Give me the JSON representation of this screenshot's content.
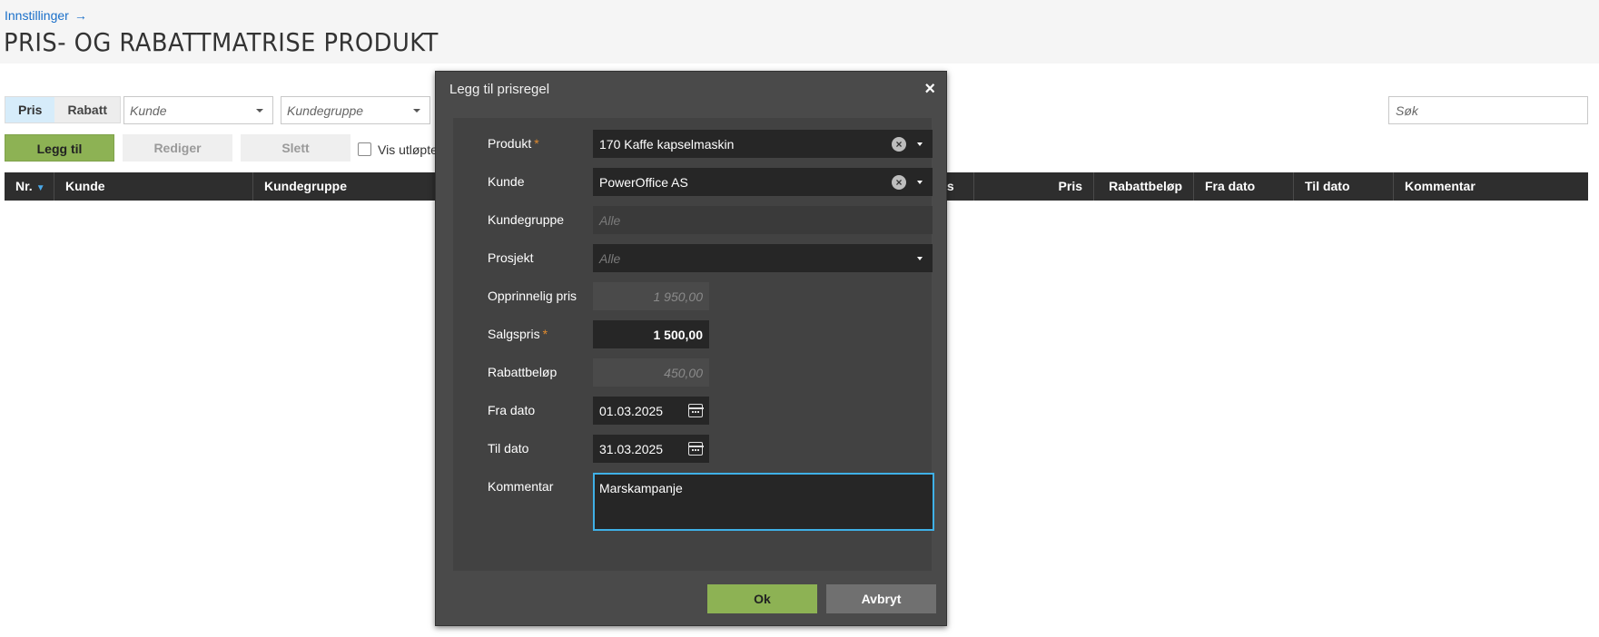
{
  "header": {
    "breadcrumb": "Innstillinger",
    "breadcrumb_arrow": "→",
    "title": "PRIS- OG RABATTMATRISE PRODUKT"
  },
  "toolbar": {
    "segments": [
      "Pris",
      "Rabatt"
    ],
    "active_segment": "Pris",
    "customer_placeholder": "Kunde",
    "customer_group_placeholder": "Kundegruppe",
    "search_placeholder": "Søk",
    "add_label": "Legg til",
    "edit_label": "Rediger",
    "delete_label": "Slett",
    "show_expired_label": "Vis utløpte"
  },
  "grid": {
    "columns": [
      "Nr.",
      "Kunde",
      "Kundegruppe",
      "is",
      "Pris",
      "Rabattbeløp",
      "Fra dato",
      "Til dato",
      "Kommentar"
    ]
  },
  "modal": {
    "title": "Legg til prisregel",
    "close": "×",
    "fields": {
      "product_label": "Produkt",
      "product_value": "170 Kaffe kapselmaskin",
      "customer_label": "Kunde",
      "customer_value": "PowerOffice AS",
      "customer_group_label": "Kundegruppe",
      "customer_group_placeholder": "Alle",
      "project_label": "Prosjekt",
      "project_placeholder": "Alle",
      "original_price_label": "Opprinnelig pris",
      "original_price_value": "1 950,00",
      "sales_price_label": "Salgspris",
      "sales_price_value": "1 500,00",
      "discount_label": "Rabattbeløp",
      "discount_value": "450,00",
      "from_date_label": "Fra dato",
      "from_date_value": "01.03.2025",
      "to_date_label": "Til dato",
      "to_date_value": "31.03.2025",
      "comment_label": "Kommentar",
      "comment_value": "Marskampanje"
    },
    "required_mark": "*",
    "ok_label": "Ok",
    "cancel_label": "Avbryt"
  },
  "colors": {
    "accent_green": "#8db254",
    "focus_blue": "#3fb0e6",
    "link_blue": "#1a6fc9",
    "required_orange": "#e08a2e"
  }
}
